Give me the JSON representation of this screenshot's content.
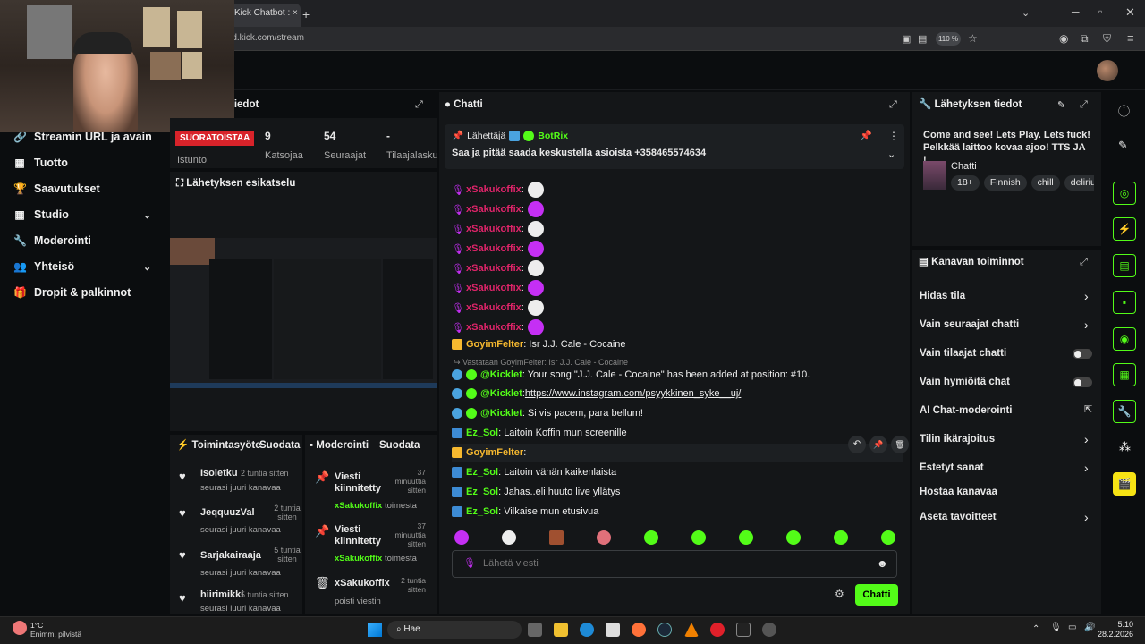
{
  "browser": {
    "tab_title": "Kick Chatbot :",
    "new_tab": "+",
    "url": "rd.kick.com/stream",
    "zoom": "110 %"
  },
  "sidebar": {
    "partial_title": "tiedot",
    "items": [
      {
        "label": "Streamin URL ja avain",
        "icon": "link-icon"
      },
      {
        "label": "Tuotto",
        "icon": "dollar-icon"
      },
      {
        "label": "Saavutukset",
        "icon": "trophy-icon"
      },
      {
        "label": "Studio",
        "icon": "studio-icon",
        "chevron": true
      },
      {
        "label": "Moderointi",
        "icon": "wrench-icon"
      },
      {
        "label": "Yhteisö",
        "icon": "community-icon",
        "chevron": true
      },
      {
        "label": "Dropit & palkinnot",
        "icon": "gift-icon"
      }
    ]
  },
  "stats": {
    "live_badge": "SUORATOISTAA",
    "session_label": "Istunto",
    "viewers": "9",
    "viewers_label": "Katsojaa",
    "followers": "54",
    "followers_label": "Seuraajat",
    "subs": "-",
    "subs_label": "Tilaajalasku"
  },
  "preview": {
    "title": "Lähetyksen esikatselu"
  },
  "activity": {
    "title": "Toimintasyöte",
    "subtitle": "Suodata",
    "items": [
      {
        "name": "Isoletku",
        "time": "2 tuntia sitten",
        "desc": "seurasi juuri kanavaa"
      },
      {
        "name": "JeqquuzVal",
        "time": "2 tuntia sitten",
        "desc": "seurasi juuri kanavaa"
      },
      {
        "name": "Sarjakairaaja",
        "time": "5 tuntia sitten",
        "desc": "seurasi juuri kanavaa"
      },
      {
        "name": "hiirimikki",
        "time": "5 tuntia sitten",
        "desc": "seurasi juuri kanavaa"
      }
    ]
  },
  "moderation": {
    "title": "Moderointi",
    "subtitle": "Suodata",
    "items": [
      {
        "title": "Viesti kiinnitetty",
        "time": "37 minuuttia sitten",
        "user": "xSakukoffix",
        "suffix": "toimesta"
      },
      {
        "title": "Viesti kiinnitetty",
        "time": "37 minuuttia sitten",
        "user": "xSakukoffix",
        "suffix": "toimesta"
      },
      {
        "title": "xSakukoffix",
        "time": "2 tuntia sitten",
        "desc": "poisti viestin"
      }
    ]
  },
  "chat": {
    "title": "Chatti",
    "pinned": {
      "label": "Lähettäjä",
      "sender": "BotRix",
      "text": "Saa ja pitää saada keskustella asioista +358465574634"
    },
    "emote_user": "xSakukoffix",
    "messages": [
      {
        "user": "GoyimFelter",
        "color": "#f7b92f",
        "text": ": Isr J.J. Cale - Cocaine"
      },
      {
        "reply": "Vastataan GoyimFelter: Isr J.J. Cale - Cocaine"
      },
      {
        "user": "@Kicklet",
        "color": "#53fc18",
        "text": ": Your song \"J.J. Cale - Cocaine\" has been added at position: #10."
      },
      {
        "user": "@Kicklet",
        "color": "#53fc18",
        "text": ": ",
        "link": "https://www.instagram.com/psyykkinen_syke__uj/"
      },
      {
        "user": "@Kicklet",
        "color": "#53fc18",
        "text": ": Si vis pacem, para bellum!"
      },
      {
        "user": "Ez_Sol",
        "color": "#53fc18",
        "text": ": Laitoin Koffin mun screenille"
      },
      {
        "user": "GoyimFelter",
        "color": "#f7b92f",
        "text": ":"
      },
      {
        "user": "Ez_Sol",
        "color": "#53fc18",
        "text": ": Laitoin vähän kaikenlaista"
      },
      {
        "user": "Ez_Sol",
        "color": "#53fc18",
        "text": ": Jahas..eli huuto live yllätys"
      },
      {
        "user": "Ez_Sol",
        "color": "#53fc18",
        "text": ": Vilkaise mun etusivua"
      }
    ],
    "input_placeholder": "Lähetä viesti",
    "send_label": "Chatti"
  },
  "stream_info": {
    "title": "Lähetyksen tiedot",
    "stream_title": "Come and see! Lets Play. Lets fuck! Pelkkää laittoo kovaa ajoo! TTS JA !...",
    "category": "Chatti",
    "tags": [
      "18+",
      "Finnish",
      "chill",
      "deliriu"
    ]
  },
  "channel_actions": {
    "title": "Kanavan toiminnot",
    "items": [
      {
        "label": "Hidas tila",
        "control": "arrow"
      },
      {
        "label": "Vain seuraajat chatti",
        "control": "arrow"
      },
      {
        "label": "Vain tilaajat chatti",
        "control": "toggle"
      },
      {
        "label": "Vain hymiöitä chat",
        "control": "toggle"
      },
      {
        "label": "AI Chat-moderointi",
        "control": "external"
      },
      {
        "label": "Tilin ikärajoitus",
        "control": "arrow"
      },
      {
        "label": "Estetyt sanat",
        "control": "arrow"
      },
      {
        "label": "Hostaa kanavaa",
        "control": "none"
      },
      {
        "label": "Aseta tavoitteet",
        "control": "arrow"
      }
    ]
  },
  "taskbar": {
    "weather_temp": "1°C",
    "weather_desc": "Enimm. pilvistä",
    "search": "Hae",
    "time": "5.10",
    "date": "28.2.2026"
  },
  "colors": {
    "accent": "#53fc18",
    "live": "#d8232a",
    "mod": "#c52ff4"
  }
}
